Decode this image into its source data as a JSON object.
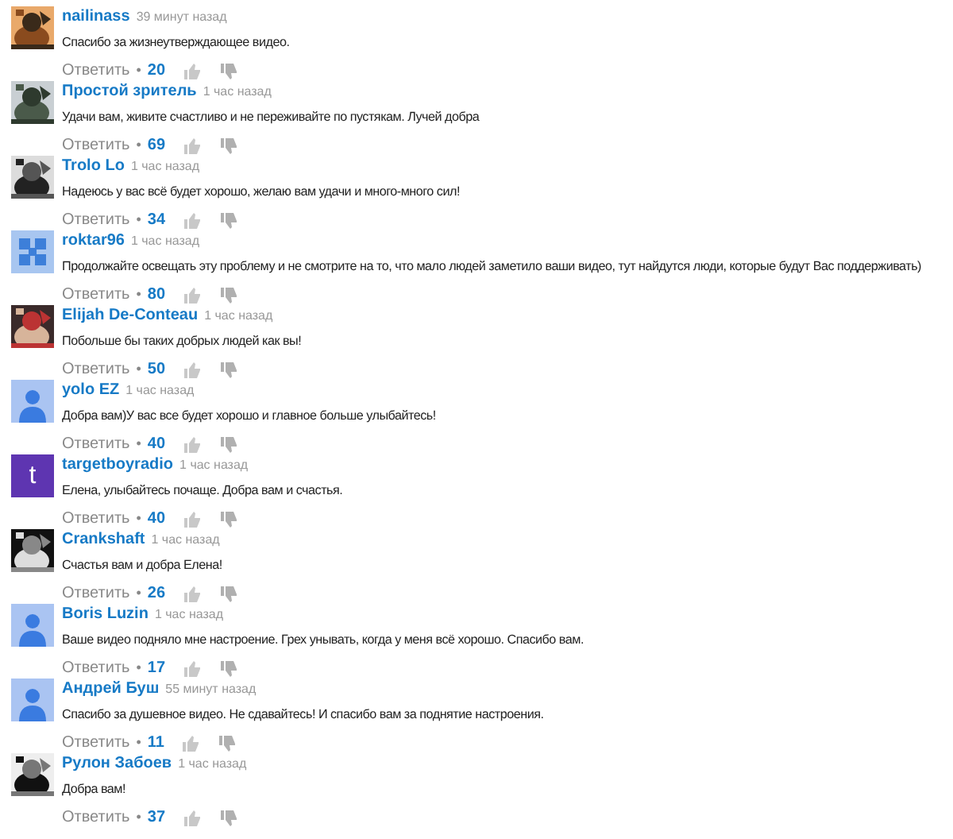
{
  "comments": [
    {
      "author": "nailinass",
      "time": "39 минут назад",
      "text": "Спасибо за жизнеутверждающее видео.",
      "reply": "Ответить",
      "separator": "•",
      "likes": "20"
    },
    {
      "author": "Простой зритель",
      "time": "1 час назад",
      "text": "Удачи вам, живите счастливо и не переживайте по пустякам. Лучей добра",
      "reply": "Ответить",
      "separator": "•",
      "likes": "69"
    },
    {
      "author": "Trolo Lo",
      "time": "1 час назад",
      "text": "Надеюсь у вас всё будет хорошо, желаю вам удачи и много-много сил!",
      "reply": "Ответить",
      "separator": "•",
      "likes": "34"
    },
    {
      "author": "roktar96",
      "time": "1 час назад",
      "text": "Продолжайте освещать эту проблему и не смотрите на то, что мало людей заметило ваши видео, тут найдутся люди, которые будут Вас поддерживать)",
      "reply": "Ответить",
      "separator": "•",
      "likes": "80",
      "avatar": {
        "kind": "pattern"
      }
    },
    {
      "author": "Elijah De-Conteau",
      "time": "1 час назад",
      "text": "Побольше бы таких добрых людей как вы!",
      "reply": "Ответить",
      "separator": "•",
      "likes": "50"
    },
    {
      "author": "yolo EZ",
      "time": "1 час назад",
      "text": "Добра вам)У вас все будет хорошо и главное больше улыбайтесь!",
      "reply": "Ответить",
      "separator": "•",
      "likes": "40",
      "avatar": {
        "kind": "default"
      }
    },
    {
      "author": "targetboyradio",
      "time": "1 час назад",
      "text": "Елена, улыбайтесь почаще. Добра вам и счастья.",
      "reply": "Ответить",
      "separator": "•",
      "likes": "40",
      "avatar": {
        "kind": "letter",
        "letter": "t",
        "color": "#5e35b1"
      }
    },
    {
      "author": "Crankshaft",
      "time": "1 час назад",
      "text": "Счастья вам и добра Елена!",
      "reply": "Ответить",
      "separator": "•",
      "likes": "26"
    },
    {
      "author": "Boris Luzin",
      "time": "1 час назад",
      "text": "Ваше видео подняло мне настроение. Грех унывать, когда у меня всё хорошо. Спасибо вам.",
      "reply": "Ответить",
      "separator": "•",
      "likes": "17",
      "avatar": {
        "kind": "default"
      }
    },
    {
      "author": "Андрей Буш",
      "time": "55 минут назад",
      "text": "Спасибо за душевное видео. Не сдавайтесь! И спасибо вам за поднятие настроения.",
      "reply": "Ответить",
      "separator": "•",
      "likes": "11",
      "avatar": {
        "kind": "default"
      }
    },
    {
      "author": "Рулон Забоев",
      "time": "1 час назад",
      "text": "Добра вам!",
      "reply": "Ответить",
      "separator": "•",
      "likes": "37"
    }
  ]
}
